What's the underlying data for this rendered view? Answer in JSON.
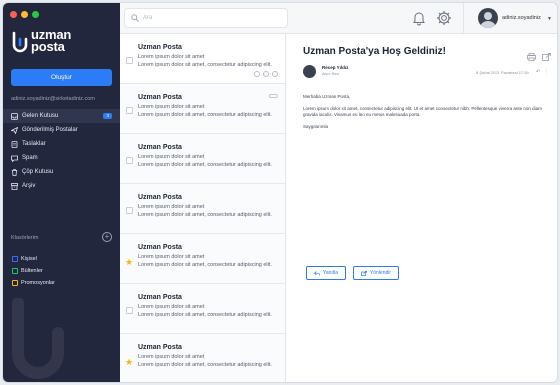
{
  "window": {
    "controls": [
      "#ff5f57",
      "#ffbd2e",
      "#28c840"
    ]
  },
  "brand": {
    "line1": "uzman",
    "line2": "posta",
    "color": "#2b7cf6"
  },
  "compose_label": "Oluştur",
  "account_email": "adiniz.soyadiniz@sirketadiniz.com",
  "nav": [
    {
      "label": "Gelen Kutusu",
      "icon": "inbox-icon",
      "active": true,
      "badge": "3"
    },
    {
      "label": "Gönderilmiş Postalar",
      "icon": "send-icon",
      "active": false,
      "badge": ""
    },
    {
      "label": "Taslaklar",
      "icon": "draft-icon",
      "active": false,
      "badge": ""
    },
    {
      "label": "Spam",
      "icon": "spam-icon",
      "active": false,
      "badge": ""
    },
    {
      "label": "Çöp Kutusu",
      "icon": "trash-icon",
      "active": false,
      "badge": ""
    },
    {
      "label": "Arşiv",
      "icon": "archive-icon",
      "active": false,
      "badge": ""
    }
  ],
  "folders": {
    "title": "Klasörlerim",
    "items": [
      {
        "label": "Kişisel",
        "color": "#3b6bff"
      },
      {
        "label": "Bültenler",
        "color": "#25c16f"
      },
      {
        "label": "Promosyonlar",
        "color": "#f5b900"
      }
    ]
  },
  "search": {
    "placeholder": "Ara"
  },
  "user": {
    "name": "adiniz.soyadiniz"
  },
  "mails": [
    {
      "from": "Uzman Posta",
      "line1": "Lorem ipsum dolor sit amet",
      "line2": "Lorem ipsum dolor sit amet, consectetur adipiscing elit.",
      "starred": false
    },
    {
      "from": "Uzman Posta",
      "line1": "Lorem ipsum dolor sit amet",
      "line2": "Lorem ipsum dolor sit amet, consectetur adipiscing elit.",
      "starred": false
    },
    {
      "from": "Uzman Posta",
      "line1": "Lorem ipsum dolor sit amet",
      "line2": "Lorem ipsum dolor sit amet, consectetur adipiscing elit.",
      "starred": false
    },
    {
      "from": "Uzman Posta",
      "line1": "Lorem ipsum dolor sit amet",
      "line2": "Lorem ipsum dolor sit amet, consectetur adipiscing elit.",
      "starred": false
    },
    {
      "from": "Uzman Posta",
      "line1": "Lorem ipsum dolor sit amet",
      "line2": "Lorem ipsum dolor sit amet, consectetur adipiscing elit.",
      "starred": true
    },
    {
      "from": "Uzman Posta",
      "line1": "Lorem ipsum dolor sit amet",
      "line2": "Lorem ipsum dolor sit amet, consectetur adipiscing elit.",
      "starred": false
    },
    {
      "from": "Uzman Posta",
      "line1": "Lorem ipsum dolor sit amet",
      "line2": "Lorem ipsum dolor sit amet, consectetur adipiscing elit.",
      "starred": true
    }
  ],
  "reader": {
    "subject": "Uzman Posta'ya Hoş Geldiniz!",
    "sender_name": "Recep Yıldız",
    "sender_to": "Alıcı: Ben",
    "date": "8 Şubat 2021 Pazartesi 17:39",
    "greeting": "Merhaba Uzman Posta,",
    "paragraph": "Lorem ipsum dolor sit amet, consectetur adipiscing elit. Ut et amet consectetur nibh. Pellentesque viverra ante non diam gravida iaculis. Vivamus eu leo eu metus malesuada porta.",
    "closing": "Saygılarımla",
    "reply_label": "Yanıtla",
    "forward_label": "Yönlendir"
  }
}
